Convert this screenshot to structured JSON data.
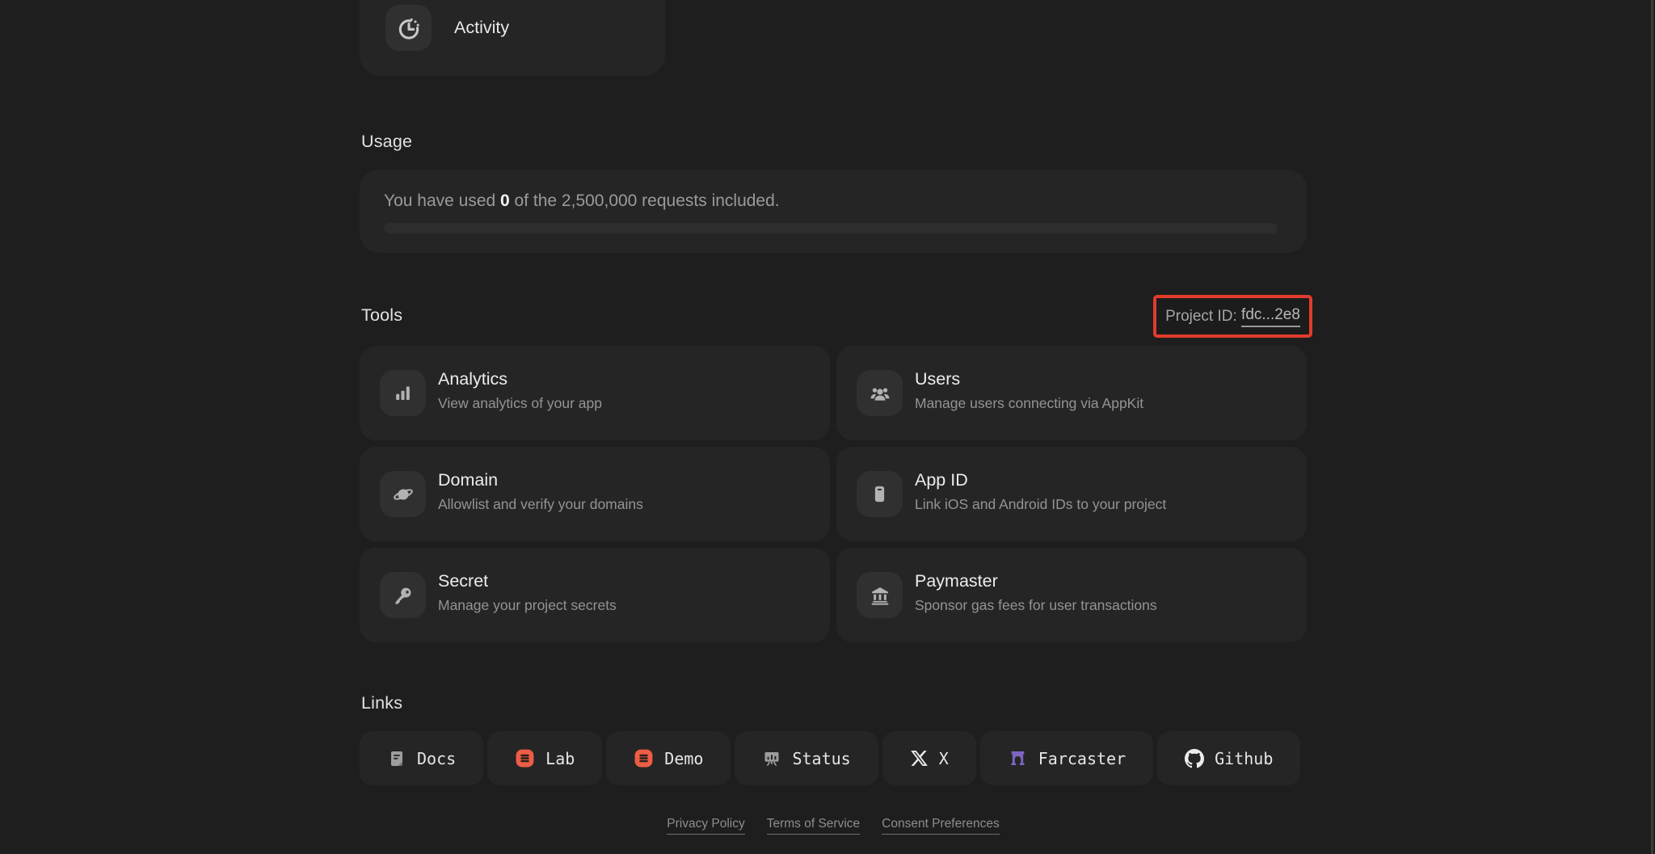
{
  "colors": {
    "page_background": "#1e1e1e",
    "card_background": "#252525",
    "highlight_red": "#e23b2b",
    "appkit_orange": "#ee5d45",
    "farcaster_purple": "#7c65c1"
  },
  "activity": {
    "label": "Activity",
    "icon": "timer-icon"
  },
  "usage": {
    "heading": "Usage",
    "line_prefix": "You have used ",
    "used": "0",
    "line_suffix": " of the 2,500,000 requests included.",
    "progress_percent": 0
  },
  "tools": {
    "heading": "Tools",
    "project_id": {
      "label": "Project ID: ",
      "value": "fdc...2e8"
    },
    "cards": [
      {
        "title": "Analytics",
        "description": "View analytics of your app",
        "icon": "bar-chart-icon"
      },
      {
        "title": "Users",
        "description": "Manage users connecting via AppKit",
        "icon": "users-icon"
      },
      {
        "title": "Domain",
        "description": "Allowlist and verify your domains",
        "icon": "planet-icon"
      },
      {
        "title": "App ID",
        "description": "Link iOS and Android IDs to your project",
        "icon": "phone-icon"
      },
      {
        "title": "Secret",
        "description": "Manage your project secrets",
        "icon": "key-icon"
      },
      {
        "title": "Paymaster",
        "description": "Sponsor gas fees for user transactions",
        "icon": "bank-icon"
      }
    ]
  },
  "links": {
    "heading": "Links",
    "items": [
      {
        "label": "Docs",
        "icon": "docs-icon"
      },
      {
        "label": "Lab",
        "icon": "appkit-icon"
      },
      {
        "label": "Demo",
        "icon": "appkit-icon"
      },
      {
        "label": "Status",
        "icon": "status-board-icon"
      },
      {
        "label": "X",
        "icon": "x-icon"
      },
      {
        "label": "Farcaster",
        "icon": "farcaster-icon"
      },
      {
        "label": "Github",
        "icon": "github-icon"
      }
    ]
  },
  "footer": {
    "links": [
      "Privacy Policy",
      "Terms of Service",
      "Consent Preferences"
    ]
  }
}
